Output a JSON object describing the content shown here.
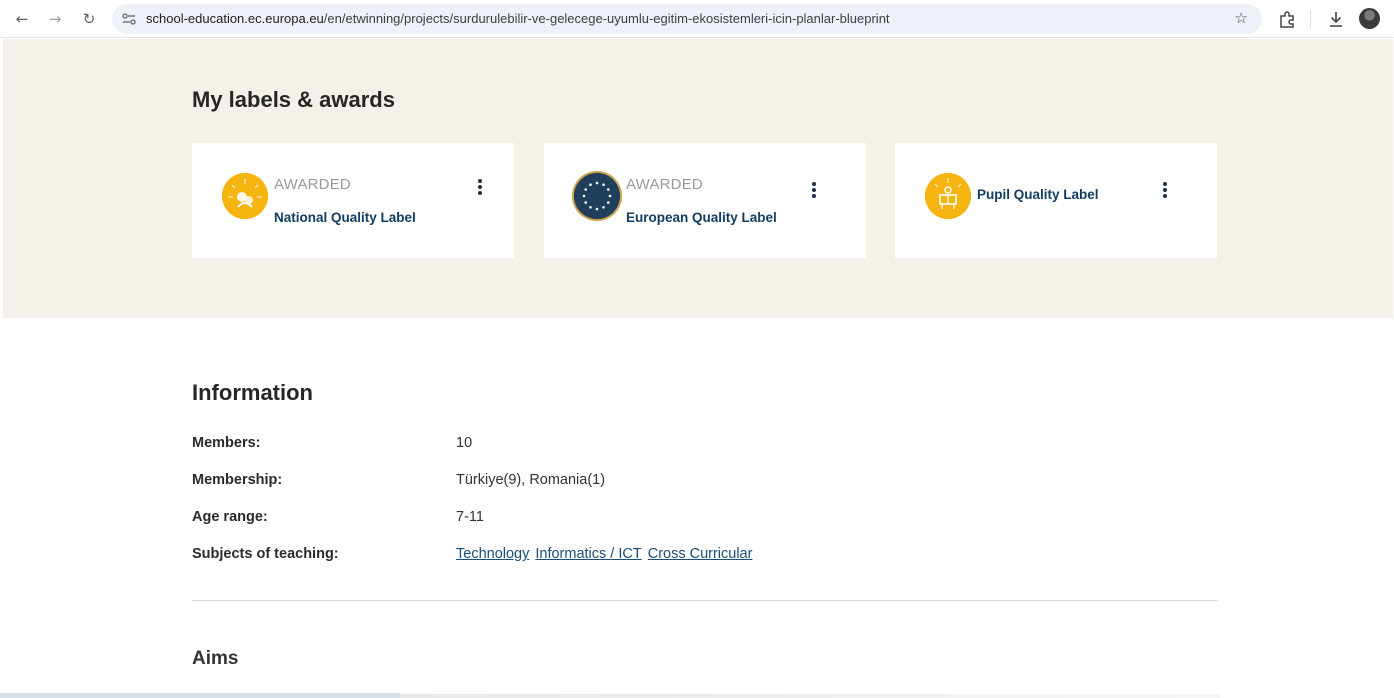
{
  "browser": {
    "url_host": "school-education.ec.europa.eu",
    "url_path": "/en/etwinning/projects/surdurulebilir-ve-gelecege-uyumlu-egitim-ekosistemleri-icin-planlar-blueprint"
  },
  "awards": {
    "title": "My labels & awards",
    "cards": [
      {
        "status": "AWARDED",
        "name": "National Quality Label",
        "icon": "national-quality-badge-icon"
      },
      {
        "status": "AWARDED",
        "name": "European Quality Label",
        "icon": "european-quality-badge-icon"
      },
      {
        "status": "",
        "name": "Pupil Quality Label",
        "icon": "pupil-quality-badge-icon"
      }
    ]
  },
  "information": {
    "title": "Information",
    "members_label": "Members:",
    "members_value": "10",
    "membership_label": "Membership:",
    "membership_value": "Türkiye(9), Romania(1)",
    "age_label": "Age range:",
    "age_value": "7-11",
    "subjects_label": "Subjects of teaching:",
    "subjects": [
      "Technology",
      "Informatics / ICT",
      "Cross Curricular"
    ]
  },
  "aims": {
    "title": "Aims"
  },
  "colors": {
    "band": "#f5f0ea",
    "gold": "#f5b40f",
    "eu_blue": "#1f3f5c",
    "link": "#1b4e7a"
  }
}
